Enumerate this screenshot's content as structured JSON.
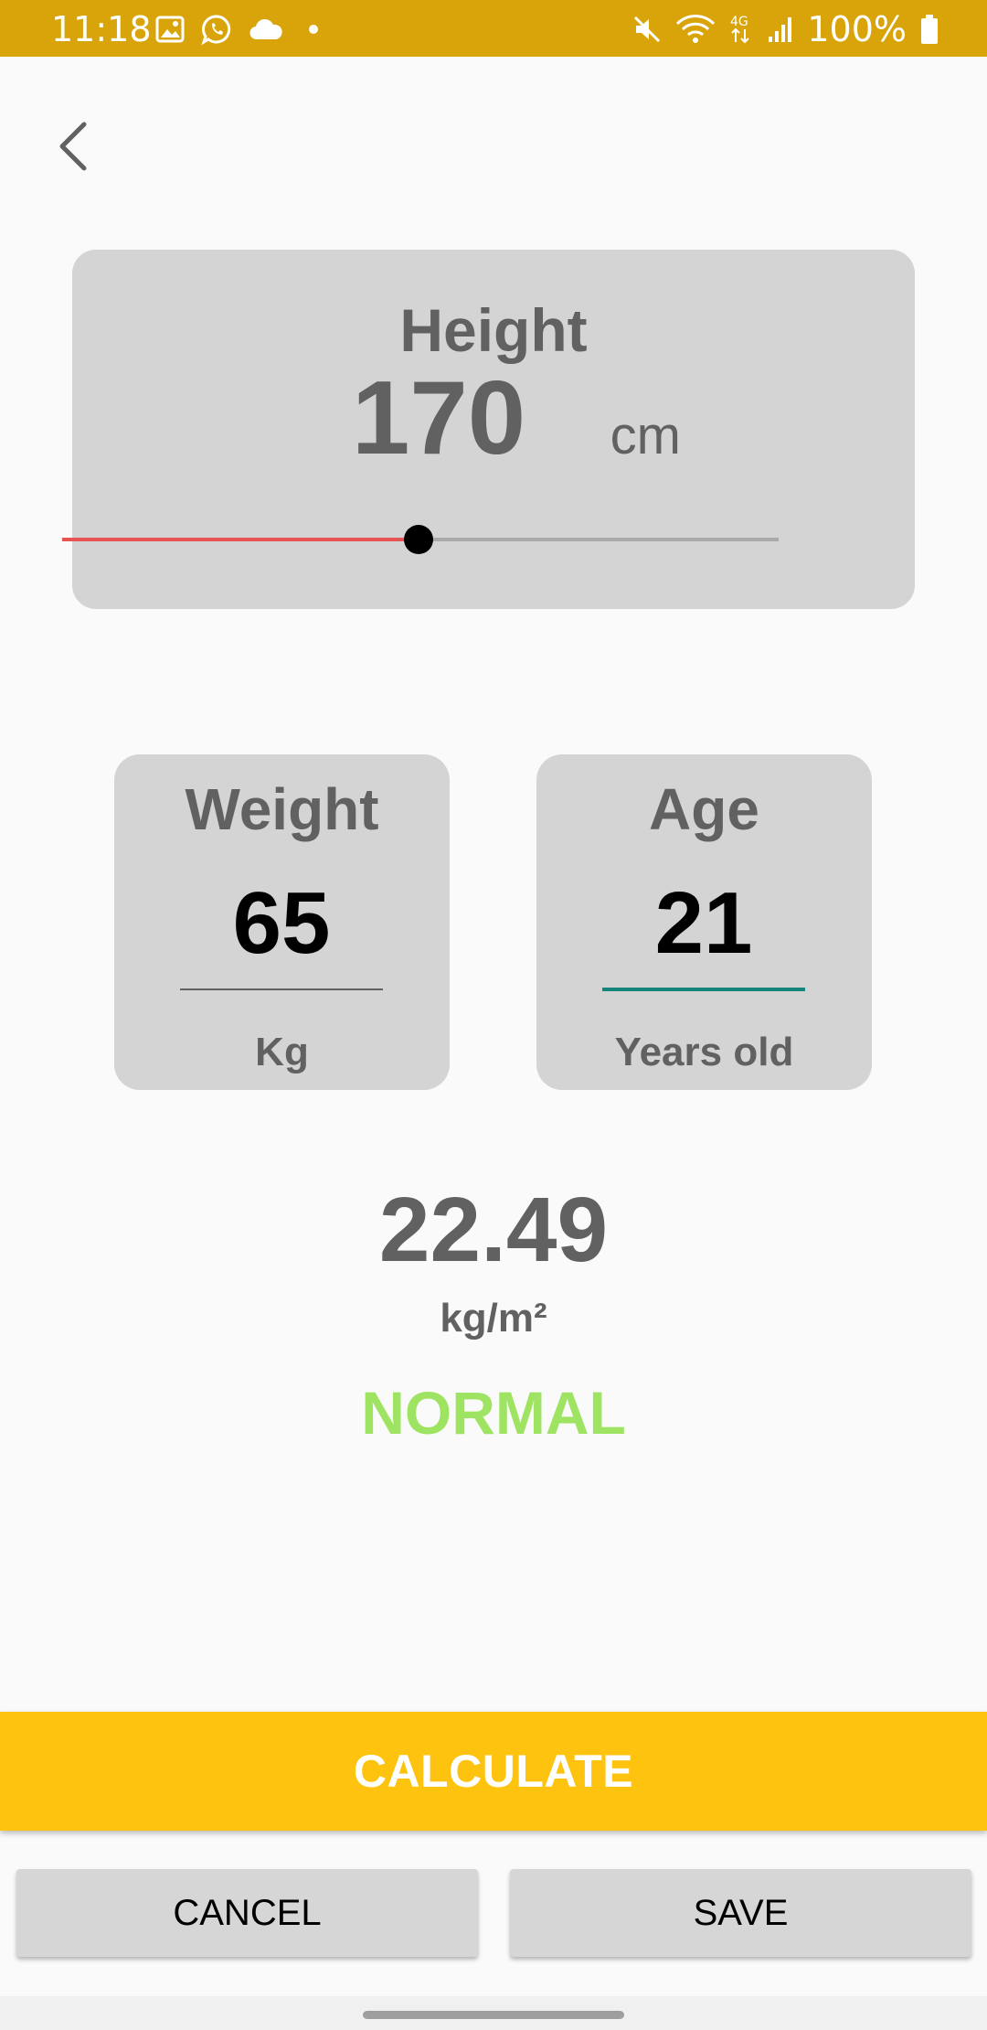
{
  "status_bar": {
    "time": "11:18",
    "left_icons": [
      "gallery-icon",
      "whatsapp-icon",
      "cloud-icon",
      "dot-icon"
    ],
    "right_icons": [
      "mute-icon",
      "wifi-icon",
      "network-4g-icon",
      "signal-icon"
    ],
    "battery_text": "100%",
    "color": "#d9a40a"
  },
  "header": {
    "back_icon": "chevron-left-icon"
  },
  "height": {
    "label": "Height",
    "value": "170",
    "unit": "cm",
    "slider_fraction": 0.498,
    "track_color": "#a9a9a9",
    "fill_color": "#e85454"
  },
  "weight": {
    "label": "Weight",
    "value": "65",
    "unit": "Kg"
  },
  "age": {
    "label": "Age",
    "value": "21",
    "unit": "Years old",
    "focus_color": "#15877a"
  },
  "result": {
    "value": "22.49",
    "unit": "kg/m²",
    "status": "NORMAL",
    "status_color": "#9ee462"
  },
  "actions": {
    "calculate_label": "CALCULATE",
    "calculate_color": "#fdc30e",
    "cancel_label": "CANCEL",
    "save_label": "SAVE"
  }
}
